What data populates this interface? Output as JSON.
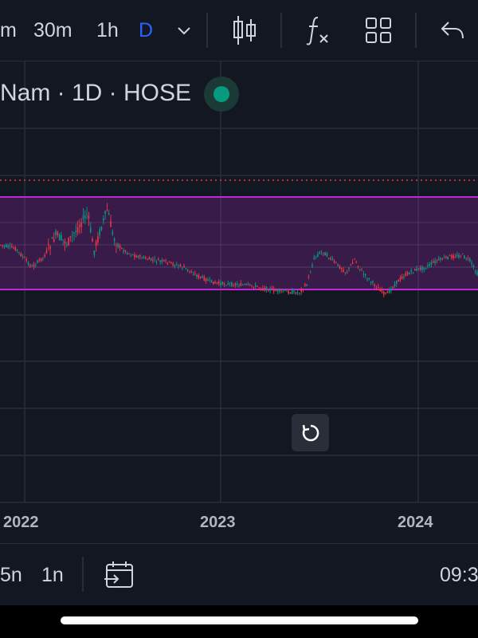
{
  "toolbar": {
    "intervals": [
      {
        "label": "m"
      },
      {
        "label": "30m"
      },
      {
        "label": "1h"
      },
      {
        "label": "D"
      }
    ],
    "active_interval": "D",
    "icons": [
      "chevron-down-icon",
      "candlestick-icon",
      "indicators-fx-icon",
      "layout-grid-icon",
      "undo-icon"
    ]
  },
  "symbol": {
    "title": "Nam · 1D · HOSE",
    "market_status_color": "#089981"
  },
  "chart_data": {
    "type": "candlestick",
    "x_tick_labels": [
      "2022",
      "2023",
      "2024"
    ],
    "range_band": {
      "color": "#9c27b0"
    },
    "last_price_line": {
      "style": "dotted",
      "color": "#f23645"
    },
    "up_color": "#089981",
    "down_color": "#f23645"
  },
  "bottom_bar": {
    "ranges": [
      {
        "label": "5n"
      },
      {
        "label": "1n"
      }
    ],
    "time": "09:3",
    "icons": [
      "go-to-date-icon"
    ]
  },
  "colors": {
    "background": "#131722",
    "grid": "#2a2e39",
    "accent": "#2962ff"
  }
}
